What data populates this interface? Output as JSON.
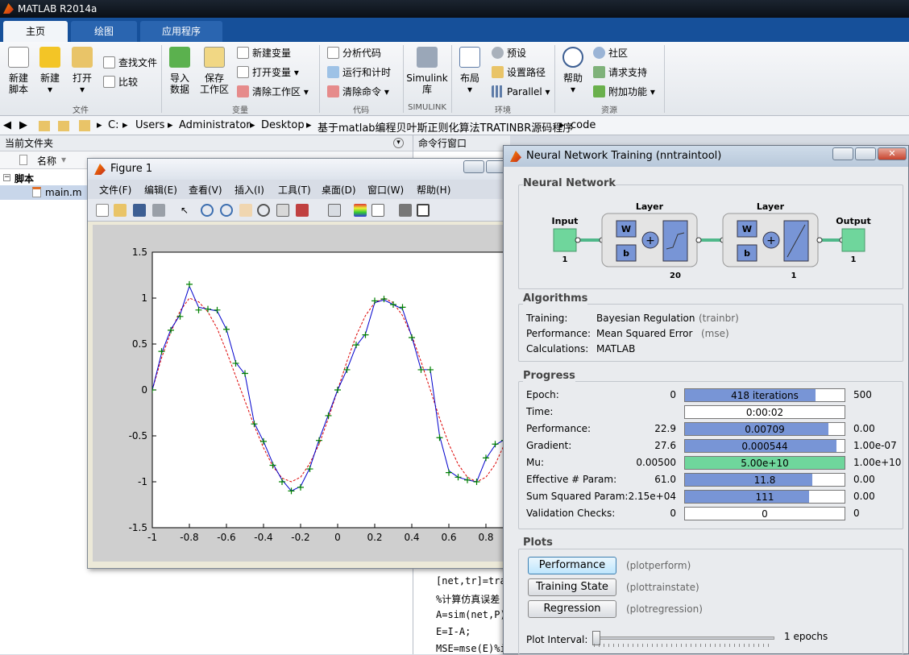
{
  "app": {
    "title": "MATLAB R2014a"
  },
  "tabs": [
    {
      "label": "主页"
    },
    {
      "label": "绘图"
    },
    {
      "label": "应用程序"
    }
  ],
  "ribbon": {
    "file": {
      "new_script": "新建\n脚本",
      "new": "新建",
      "open": "打开",
      "find_files": "查找文件",
      "compare": "比较",
      "group": "文件"
    },
    "variable": {
      "import": "导入\n数据",
      "save_ws": "保存\n工作区",
      "new_var": "新建变量",
      "open_var": "打开变量",
      "clear_ws": "清除工作区",
      "group": "变量"
    },
    "code": {
      "analyze": "分析代码",
      "run_time": "运行和计时",
      "clear_cmd": "清除命令",
      "group": "代码"
    },
    "simulink": {
      "lib": "Simulink\n库",
      "group": "SIMULINK"
    },
    "env": {
      "layout": "布局",
      "prefs": "预设",
      "set_path": "设置路径",
      "parallel": "Parallel",
      "group": "环境"
    },
    "res": {
      "help": "帮助",
      "community": "社区",
      "support": "请求支持",
      "addons": "附加功能",
      "group": "资源"
    }
  },
  "address": {
    "crumbs": [
      "C:",
      "Users",
      "Administrator",
      "Desktop",
      "基于matlab编程贝叶斯正则化算法TRATINBR源码程序",
      "code"
    ]
  },
  "current_folder": {
    "title": "当前文件夹",
    "col_name": "名称",
    "group": "脚本",
    "file": "main.m"
  },
  "command_window": {
    "title": "命令行窗口",
    "lines": [
      "[net,tr]=tra",
      "%计算仿真误差",
      "A=sim(net,P)",
      "E=I-A;",
      "MSE=mse(E)%i"
    ]
  },
  "figure": {
    "title": "Figure 1",
    "menu": [
      "文件(F)",
      "编辑(E)",
      "查看(V)",
      "插入(I)",
      "工具(T)",
      "桌面(D)",
      "窗口(W)",
      "帮助(H)"
    ]
  },
  "chart_data": {
    "type": "line",
    "xlim": [
      -1,
      1
    ],
    "ylim": [
      -1.5,
      1.5
    ],
    "xticks": [
      "-1",
      "-0.8",
      "-0.6",
      "-0.4",
      "-0.2",
      "0",
      "0.2",
      "0.4",
      "0.6",
      "0.8"
    ],
    "yticks": [
      "1.5",
      "1",
      "0.5",
      "0",
      "-0.5",
      "-1",
      "-1.5"
    ],
    "grid": false,
    "series": [
      {
        "style": "markers +",
        "color": "#008000",
        "x": [
          -1,
          -0.95,
          -0.9,
          -0.85,
          -0.8,
          -0.75,
          -0.7,
          -0.65,
          -0.6,
          -0.55,
          -0.5,
          -0.45,
          -0.4,
          -0.35,
          -0.3,
          -0.25,
          -0.2,
          -0.15,
          -0.1,
          -0.05,
          0,
          0.05,
          0.1,
          0.15,
          0.2,
          0.25,
          0.3,
          0.35,
          0.4,
          0.45,
          0.5,
          0.55,
          0.6,
          0.65,
          0.7,
          0.75,
          0.8,
          0.85,
          0.9,
          0.95
        ],
        "y": [
          0.0,
          0.42,
          0.65,
          0.8,
          1.15,
          0.87,
          0.88,
          0.87,
          0.66,
          0.29,
          0.18,
          -0.37,
          -0.56,
          -0.82,
          -1.0,
          -1.1,
          -1.06,
          -0.86,
          -0.55,
          -0.28,
          0.0,
          0.22,
          0.49,
          0.6,
          0.97,
          0.99,
          0.93,
          0.9,
          0.57,
          0.22,
          0.22,
          -0.52,
          -0.9,
          -0.95,
          -0.98,
          -1.0,
          -0.74,
          -0.59,
          -0.55,
          -0.3
        ]
      },
      {
        "style": "solid",
        "color": "#0000cc",
        "x": [
          -1,
          -0.95,
          -0.9,
          -0.85,
          -0.8,
          -0.75,
          -0.7,
          -0.65,
          -0.6,
          -0.55,
          -0.5,
          -0.45,
          -0.4,
          -0.35,
          -0.3,
          -0.25,
          -0.2,
          -0.15,
          -0.1,
          -0.05,
          0,
          0.05,
          0.1,
          0.15,
          0.2,
          0.25,
          0.3,
          0.35,
          0.4,
          0.45,
          0.5,
          0.55,
          0.6,
          0.65,
          0.7,
          0.75,
          0.8,
          0.85,
          0.9,
          0.95
        ],
        "y": [
          0.0,
          0.4,
          0.66,
          0.82,
          1.13,
          0.9,
          0.88,
          0.86,
          0.66,
          0.3,
          0.17,
          -0.36,
          -0.56,
          -0.8,
          -0.98,
          -1.1,
          -1.05,
          -0.85,
          -0.54,
          -0.27,
          0.0,
          0.22,
          0.48,
          0.61,
          0.95,
          0.98,
          0.93,
          0.88,
          0.58,
          0.22,
          0.22,
          -0.5,
          -0.88,
          -0.95,
          -0.98,
          -1.0,
          -0.75,
          -0.6,
          -0.54,
          -0.3
        ]
      },
      {
        "style": "dashed",
        "color": "#dd0000",
        "x": [
          -1,
          -0.95,
          -0.9,
          -0.85,
          -0.8,
          -0.75,
          -0.7,
          -0.65,
          -0.6,
          -0.55,
          -0.5,
          -0.45,
          -0.4,
          -0.35,
          -0.3,
          -0.25,
          -0.2,
          -0.15,
          -0.1,
          -0.05,
          0,
          0.05,
          0.1,
          0.15,
          0.2,
          0.25,
          0.3,
          0.35,
          0.4,
          0.45,
          0.5,
          0.55,
          0.6,
          0.65,
          0.7,
          0.75,
          0.8,
          0.85,
          0.9,
          0.95
        ],
        "y": [
          0.0,
          0.35,
          0.63,
          0.86,
          1.0,
          0.96,
          0.85,
          0.67,
          0.42,
          0.15,
          -0.12,
          -0.39,
          -0.63,
          -0.83,
          -0.96,
          -1.0,
          -0.95,
          -0.8,
          -0.59,
          -0.31,
          0.0,
          0.31,
          0.59,
          0.81,
          0.95,
          1.0,
          0.95,
          0.81,
          0.59,
          0.31,
          0.0,
          -0.31,
          -0.59,
          -0.81,
          -0.95,
          -1.0,
          -0.95,
          -0.81,
          -0.59,
          -0.31
        ]
      }
    ]
  },
  "nntool": {
    "title": "Neural Network Training (nntraintool)",
    "nn_section": "Neural Network",
    "diagram": {
      "input": "Input",
      "input_n": "1",
      "layer1": "Layer",
      "layer1_n": "20",
      "layer2": "Layer",
      "layer2_n": "1",
      "output": "Output",
      "output_n": "1",
      "w": "W",
      "b": "b"
    },
    "algorithms": {
      "title": "Algorithms",
      "rows": [
        {
          "label": "Training:",
          "value": "Bayesian Regulation",
          "fn": "(trainbr)"
        },
        {
          "label": "Performance:",
          "value": "Mean Squared Error",
          "fn": "(mse)"
        },
        {
          "label": "Calculations:",
          "value": "MATLAB",
          "fn": ""
        }
      ]
    },
    "progress": {
      "title": "Progress",
      "rows": [
        {
          "label": "Epoch:",
          "left": "0",
          "bar": "418 iterations",
          "right": "500",
          "fill": 0.82,
          "green": false
        },
        {
          "label": "Time:",
          "left": "",
          "bar": "0:00:02",
          "right": "",
          "fill": 0.0,
          "green": false
        },
        {
          "label": "Performance:",
          "left": "22.9",
          "bar": "0.00709",
          "right": "0.00",
          "fill": 0.9,
          "green": false
        },
        {
          "label": "Gradient:",
          "left": "27.6",
          "bar": "0.000544",
          "right": "1.00e-07",
          "fill": 0.95,
          "green": false
        },
        {
          "label": "Mu:",
          "left": "0.00500",
          "bar": "5.00e+10",
          "right": "1.00e+10",
          "fill": 1.0,
          "green": true
        },
        {
          "label": "Effective # Param:",
          "left": "61.0",
          "bar": "11.8",
          "right": "0.00",
          "fill": 0.8,
          "green": false
        },
        {
          "label": "Sum Squared Param:",
          "left": "2.15e+04",
          "bar": "111",
          "right": "0.00",
          "fill": 0.78,
          "green": false
        },
        {
          "label": "Validation Checks:",
          "left": "0",
          "bar": "0",
          "right": "0",
          "fill": 0.0,
          "green": false
        }
      ]
    },
    "plots": {
      "title": "Plots",
      "buttons": [
        {
          "label": "Performance",
          "fn": "(plotperform)"
        },
        {
          "label": "Training State",
          "fn": "(plottrainstate)"
        },
        {
          "label": "Regression",
          "fn": "(plotregression)"
        }
      ],
      "interval_label": "Plot Interval:",
      "interval_value": "1 epochs"
    }
  }
}
